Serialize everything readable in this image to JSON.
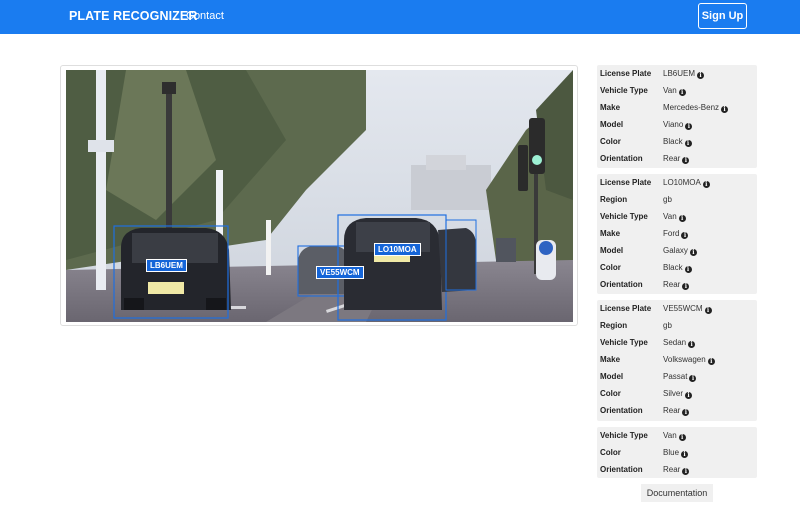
{
  "navbar": {
    "brand": "PLATE RECOGNIZER",
    "contact": "Contact",
    "signup": "Sign Up",
    "color": "#1a7cf0"
  },
  "image": {
    "plates": [
      {
        "text": "LB6UEM"
      },
      {
        "text": "VE55WCM"
      },
      {
        "text": "LO10MOA"
      }
    ]
  },
  "results": [
    {
      "fields": [
        {
          "label": "License Plate",
          "value": "LB6UEM"
        },
        {
          "label": "Vehicle Type",
          "value": "Van"
        },
        {
          "label": "Make",
          "value": "Mercedes-Benz"
        },
        {
          "label": "Model",
          "value": "Viano"
        },
        {
          "label": "Color",
          "value": "Black"
        },
        {
          "label": "Orientation",
          "value": "Rear"
        }
      ]
    },
    {
      "fields": [
        {
          "label": "License Plate",
          "value": "LO10MOA"
        },
        {
          "label": "Region",
          "value": "gb"
        },
        {
          "label": "Vehicle Type",
          "value": "Van"
        },
        {
          "label": "Make",
          "value": "Ford"
        },
        {
          "label": "Model",
          "value": "Galaxy"
        },
        {
          "label": "Color",
          "value": "Black"
        },
        {
          "label": "Orientation",
          "value": "Rear"
        }
      ]
    },
    {
      "fields": [
        {
          "label": "License Plate",
          "value": "VE55WCM"
        },
        {
          "label": "Region",
          "value": "gb"
        },
        {
          "label": "Vehicle Type",
          "value": "Sedan"
        },
        {
          "label": "Make",
          "value": "Volkswagen"
        },
        {
          "label": "Model",
          "value": "Passat"
        },
        {
          "label": "Color",
          "value": "Silver"
        },
        {
          "label": "Orientation",
          "value": "Rear"
        }
      ]
    },
    {
      "fields": [
        {
          "label": "Vehicle Type",
          "value": "Van"
        },
        {
          "label": "Color",
          "value": "Blue"
        },
        {
          "label": "Orientation",
          "value": "Rear"
        }
      ]
    }
  ],
  "info_icon": "info-circle-icon",
  "documentation": "Documentation"
}
